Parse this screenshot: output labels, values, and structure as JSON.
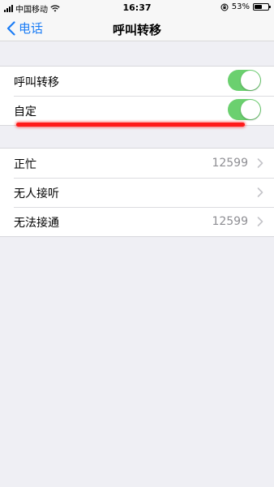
{
  "status_bar": {
    "carrier": "中国移动",
    "time": "16:37",
    "battery_percent": "53%",
    "icons": [
      "signal-icon",
      "wifi-icon",
      "orientation-lock-icon",
      "battery-icon"
    ]
  },
  "nav": {
    "back_label": "电话",
    "title": "呼叫转移"
  },
  "group1": {
    "rows": [
      {
        "label": "呼叫转移",
        "toggle_on": true
      },
      {
        "label": "自定",
        "toggle_on": true
      }
    ]
  },
  "group2": {
    "rows": [
      {
        "label": "正忙",
        "value": "12599"
      },
      {
        "label": "无人接听",
        "value": ""
      },
      {
        "label": "无法接通",
        "value": "12599"
      }
    ]
  },
  "colors": {
    "accent": "#1a7cf5",
    "toggle_on": "#6bd06f",
    "annotation": "#ff1a1a",
    "background": "#efeff4"
  }
}
